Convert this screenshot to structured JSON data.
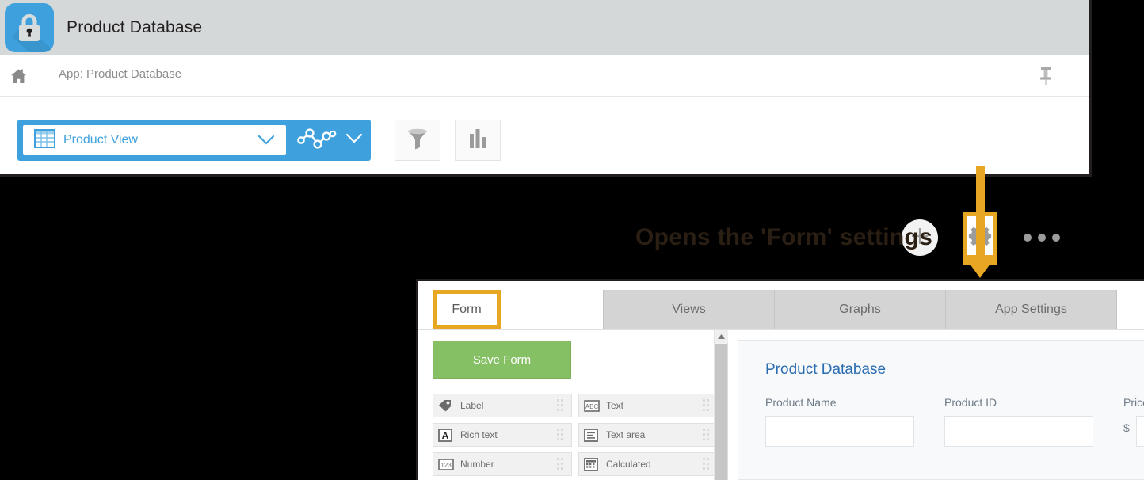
{
  "app_window": {
    "title": "Product Database",
    "logo_icon": "lock-icon",
    "breadcrumb": {
      "home_icon": "home-icon",
      "text": "App: Product Database",
      "pin_icon": "pin-icon"
    },
    "toolbar": {
      "view_icon": "table-grid-icon",
      "view_label": "Product View",
      "view_chevron_icon": "chevron-down-icon",
      "graph_icon": "line-chart-nodes-icon",
      "graph_chevron_icon": "chevron-down-icon",
      "filter_icon": "funnel-filter-icon",
      "chart_icon": "bar-chart-icon",
      "add_icon": "plus-icon",
      "gear_icon": "gear-icon",
      "more_icon": "ellipsis-icon"
    }
  },
  "annotation": {
    "text": "Opens the 'Form' settings",
    "highlight_color": "#e8a723",
    "text_color": "#2b1f14"
  },
  "settings_panel": {
    "tabs": [
      {
        "label": "Form",
        "active": true
      },
      {
        "label": "Views",
        "active": false
      },
      {
        "label": "Graphs",
        "active": false
      },
      {
        "label": "App Settings",
        "active": false
      }
    ],
    "left_pane": {
      "save_button": "Save Form",
      "fields": [
        {
          "label": "Label",
          "icon": "tag-icon"
        },
        {
          "label": "Text",
          "icon": "abc-icon"
        },
        {
          "label": "Rich text",
          "icon": "letter-a-icon"
        },
        {
          "label": "Text area",
          "icon": "text-lines-icon"
        },
        {
          "label": "Number",
          "icon": "123-icon"
        },
        {
          "label": "Calculated",
          "icon": "calculator-icon"
        }
      ],
      "scroll_up_icon": "scroll-up-arrow-icon"
    },
    "right_pane": {
      "form_title": "Product Database",
      "fields": [
        {
          "label": "Product Name",
          "value": "",
          "prefix": ""
        },
        {
          "label": "Product ID",
          "value": "",
          "prefix": ""
        },
        {
          "label": "Price",
          "value": "",
          "prefix": "$"
        }
      ]
    }
  },
  "colors": {
    "accent_blue": "#3ea1dd",
    "highlight_orange": "#e8a723",
    "save_green": "#86c065",
    "title_blue": "#2b6cb0"
  }
}
